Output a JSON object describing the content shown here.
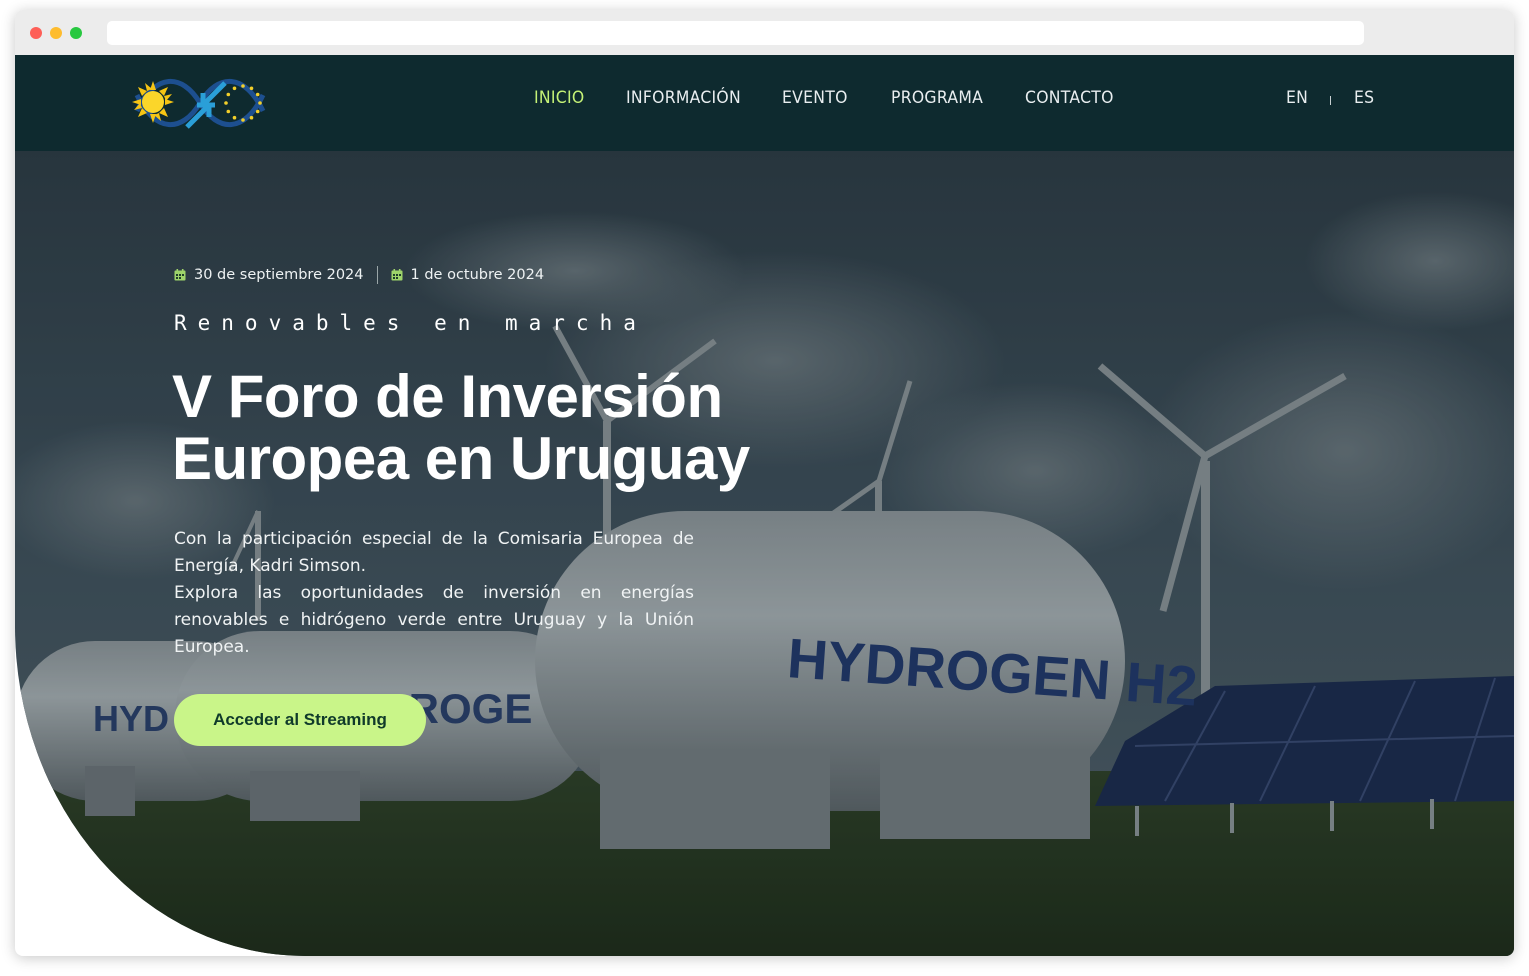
{
  "nav": {
    "items": [
      {
        "label": "INICIO",
        "active": true
      },
      {
        "label": "INFORMACIÓN",
        "active": false
      },
      {
        "label": "EVENTO",
        "active": false
      },
      {
        "label": "PROGRAMA",
        "active": false
      },
      {
        "label": "CONTACTO",
        "active": false
      }
    ],
    "languages": [
      "EN",
      "ES"
    ],
    "active_color": "#c5f277"
  },
  "hero": {
    "dates": [
      "30 de septiembre 2024",
      "1 de octubre 2024"
    ],
    "tagline": "Renovables en marcha",
    "title_lines": [
      "V Foro de Inversión",
      "Europea en Uruguay"
    ],
    "description": [
      "Con la participación especial de la Comisaria Europea de Energía, Kadri Simson.",
      "Explora las oportunidades de inversión en energías renovables e hidrógeno verde entre Uruguay y la Unión Europea."
    ],
    "cta_label": "Acceder al Streaming",
    "tank_labels": [
      "HYDROGEN H2",
      "HYDROGE",
      "HYD"
    ]
  },
  "icons": {
    "logo": "forum-logo-sun-arrows-eu-stars",
    "date": "calendar-icon"
  },
  "colors": {
    "navbar": "#0e2a2f",
    "cta_bg": "#c9f589",
    "cta_text": "#0f3a2a",
    "calendar": "#9ed46a"
  }
}
